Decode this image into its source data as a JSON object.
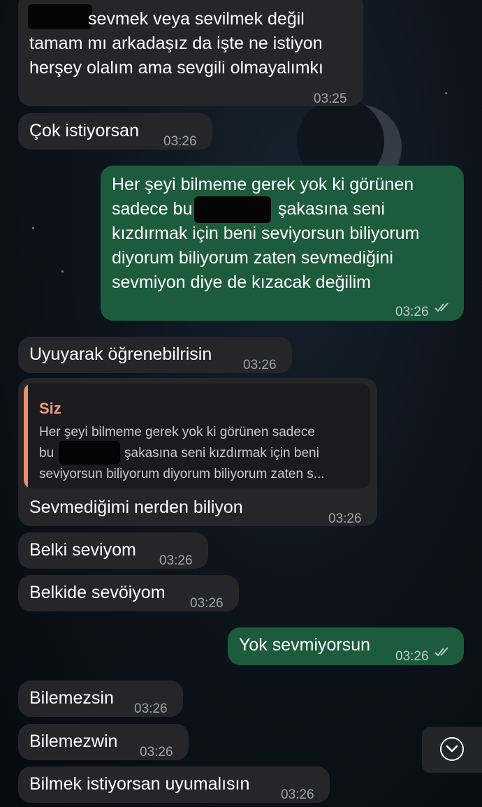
{
  "messages": [
    {
      "id": "m1",
      "direction": "incoming",
      "lines": [
        "sevmek veya sevilmek değil",
        "tamam mı arkadaşız da işte ne istiyon",
        "herşey olalım ama sevgili olmayalımkı"
      ],
      "time": "03:25"
    },
    {
      "id": "m2",
      "direction": "incoming",
      "text": "Çok istiyorsan",
      "time": "03:26"
    },
    {
      "id": "m3",
      "direction": "outgoing",
      "lines": [
        "Her şeyi bilmeme gerek yok ki görünen",
        "sadece bu",
        "şakasına seni",
        "kızdırmak için beni seviyorsun biliyorum",
        "diyorum biliyorum zaten sevmediğini",
        "sevmiyon diye de kızacak değilim"
      ],
      "time": "03:26",
      "read": true
    },
    {
      "id": "m4",
      "direction": "incoming",
      "text": "Uyuyarak öğrenebilrisin",
      "time": "03:26"
    },
    {
      "id": "m5",
      "direction": "incoming",
      "reply": {
        "author": "Siz",
        "lines": [
          "Her şeyi bilmeme gerek yok ki görünen sadece",
          "bu",
          "şakasına seni kızdırmak için beni",
          "seviyorsun biliyorum diyorum biliyorum zaten s..."
        ]
      },
      "text": "Sevmediğimi nerden biliyon",
      "time": "03:26"
    },
    {
      "id": "m6",
      "direction": "incoming",
      "text": "Belki seviyom",
      "time": "03:26"
    },
    {
      "id": "m7",
      "direction": "incoming",
      "text": "Belkide sevöiyom",
      "time": "03:26"
    },
    {
      "id": "m8",
      "direction": "outgoing",
      "text": "Yok sevmiyorsun",
      "time": "03:26",
      "read": true
    },
    {
      "id": "m9",
      "direction": "incoming",
      "text": "Bilemezsin",
      "time": "03:26"
    },
    {
      "id": "m10",
      "direction": "incoming",
      "text": "Bilemezwin",
      "time": "03:26"
    },
    {
      "id": "m11",
      "direction": "incoming",
      "text": "Bilmek istiyorsan uyumalısın",
      "time": "03:26"
    }
  ],
  "icons": {
    "read_receipt": "double-check-icon",
    "scroll_down": "chevron-down-circle-icon"
  },
  "colors": {
    "incoming_bubble": "#262628",
    "outgoing_bubble": "#1d5b3d",
    "reply_accent": "#e98f73"
  }
}
